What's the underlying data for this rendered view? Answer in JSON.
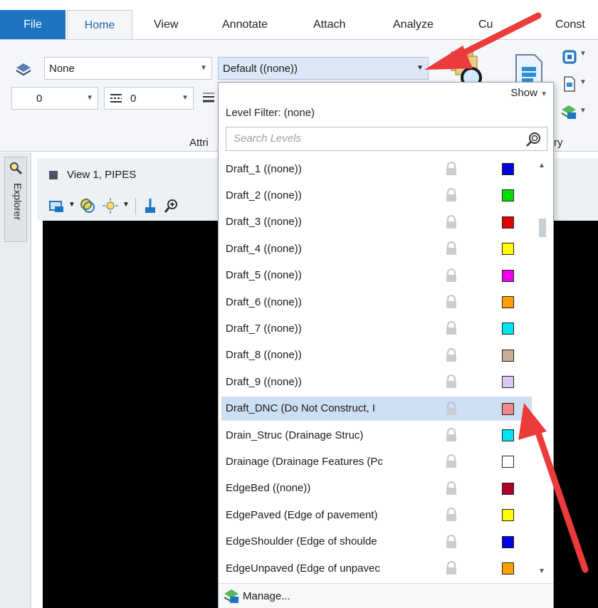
{
  "ribbon": {
    "tabs": [
      {
        "label": "File"
      },
      {
        "label": "Home"
      },
      {
        "label": "View"
      },
      {
        "label": "Annotate"
      },
      {
        "label": "Attach"
      },
      {
        "label": "Analyze"
      },
      {
        "label": "Cu"
      },
      {
        "label": "Const"
      }
    ],
    "level_display_combo": "None",
    "active_level_combo": "Default ((none))",
    "weight_combo": "0",
    "style_combo": "0",
    "group_label_attributes": "Attri",
    "group_label_partial": "ry"
  },
  "explorer": {
    "label": "Explorer"
  },
  "view": {
    "title": "View 1, PIPES"
  },
  "dropdown": {
    "show_label": "Show",
    "filter_label": "Level Filter:  (none)",
    "search_placeholder": "Search Levels",
    "manage_label": "Manage...",
    "levels": [
      {
        "name": "Draft_1 ((none))",
        "color": "#0000e0"
      },
      {
        "name": "Draft_2 ((none))",
        "color": "#00dd00"
      },
      {
        "name": "Draft_3 ((none))",
        "color": "#e00000"
      },
      {
        "name": "Draft_4 ((none))",
        "color": "#ffff00"
      },
      {
        "name": "Draft_5 ((none))",
        "color": "#ee00ee"
      },
      {
        "name": "Draft_6 ((none))",
        "color": "#ff9f00"
      },
      {
        "name": "Draft_7 ((none))",
        "color": "#00e5f0"
      },
      {
        "name": "Draft_8 ((none))",
        "color": "#c9ad8e"
      },
      {
        "name": "Draft_9 ((none))",
        "color": "#dcc8f2"
      },
      {
        "name": "Draft_DNC (Do Not Construct, I",
        "color": "#f08a8a",
        "selected": true
      },
      {
        "name": "Drain_Struc (Drainage Struc)",
        "color": "#00e5f0"
      },
      {
        "name": "Drainage (Drainage Features (Pc",
        "color": "#ffffff"
      },
      {
        "name": "EdgeBed ((none))",
        "color": "#b0002a"
      },
      {
        "name": "EdgePaved (Edge of pavement)",
        "color": "#ffff00"
      },
      {
        "name": "EdgeShoulder (Edge of shoulde",
        "color": "#0000e0"
      },
      {
        "name": "EdgeUnpaved (Edge of unpavec",
        "color": "#ff9f00"
      }
    ]
  },
  "colors": {
    "accent": "#1f74c1",
    "annotation_arrow": "#ec3b3b",
    "selected_row": "#cddff3"
  }
}
